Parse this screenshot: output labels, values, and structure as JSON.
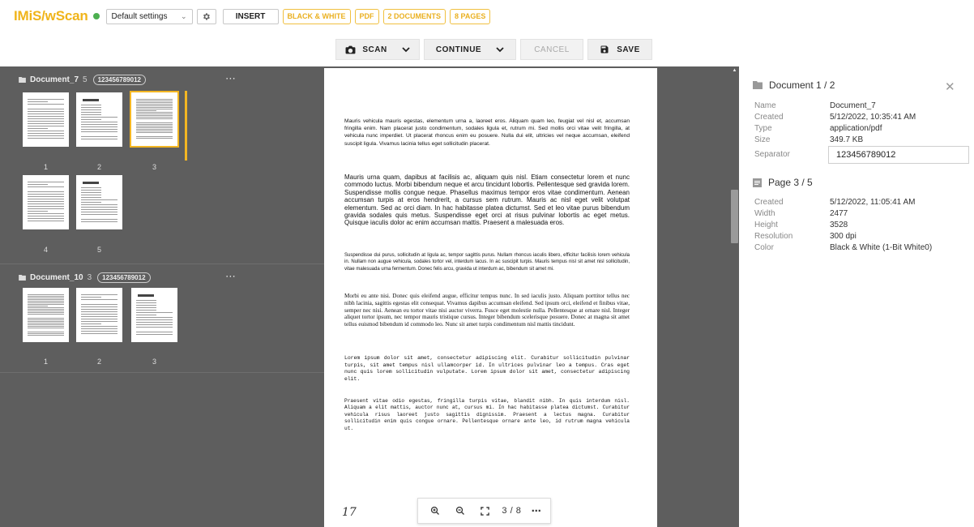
{
  "header": {
    "brand": "IMiS/wScan",
    "settings_value": "Default settings",
    "insert_label": "INSERT",
    "chips": [
      "BLACK & WHITE",
      "PDF",
      "2 DOCUMENTS",
      "8 PAGES"
    ]
  },
  "actions": {
    "scan_label": "SCAN",
    "continue_label": "CONTINUE",
    "cancel_label": "CANCEL",
    "save_label": "SAVE"
  },
  "documents": [
    {
      "name": "Document_7",
      "count": "5",
      "separator": "123456789012",
      "pages": [
        "1",
        "2",
        "3",
        "4",
        "5"
      ],
      "selected_page": "3"
    },
    {
      "name": "Document_10",
      "count": "3",
      "separator": "123456789012",
      "pages": [
        "1",
        "2",
        "3"
      ]
    }
  ],
  "viewer": {
    "paragraphs": [
      "Mauris vehicula mauris egestas, elementum urna a, laoreet eros. Aliquam quam leo, feugiat vel nisl et, accumsan fringilla enim. Nam placerat justo condimentum, sodales ligula et, rutrum mi. Sed mollis orci vitae velit fringilla, at vehicula nunc imperdiet. Ut placerat rhoncus enim eu posuere. Nulla dui elit, ultricies vel neque accumsan, eleifend suscipit ligula. Vivamus lacinia tellus eget sollicitudin placerat.",
      "Mauris urna quam, dapibus at facilisis ac, aliquam quis nisl. Etiam consectetur lorem et nunc commodo luctus. Morbi bibendum neque et arcu tincidunt lobortis. Pellentesque sed gravida lorem. Suspendisse mollis congue neque. Phasellus maximus tempor eros vitae condimentum. Aenean accumsan turpis at eros hendrerit, a cursus sem rutrum. Mauris ac nisl eget velit volutpat elementum. Sed ac orci diam. In hac habitasse platea dictumst. Sed et leo vitae purus bibendum gravida sodales quis metus. Suspendisse eget orci at risus pulvinar lobortis ac eget metus. Quisque iaculis dolor ac enim accumsan mattis. Praesent a malesuada eros.",
      "Suspendisse dui purus, sollicitudin at ligula ac, tempor sagittis purus. Nullam rhoncus iaculis libero, efficitur facilisis lorem vehicula in. Nullam non augue vehicula, sodales tortor vel, interdum lacus. In ac suscipit turpis. Mauris tempus nisl sit amet nisl sollicitudin, vitae malesuada urna fermentum. Donec felis arcu, gravida ut interdum ac, bibendum sit amet mi.",
      "Morbi eu ante nisi. Donec quis eleifend augue, efficitur tempus nunc. In sed iaculis justo. Aliquam porttitor tellus nec nibh lacinia, sagittis egestas elit consequat. Vivamus dapibus accumsan eleifend. Sed ipsum orci, eleifend et finibus vitae, semper nec nisi. Aenean eu tortor vitae nisi auctor viverra. Fusce eget molestie nulla. Pellentesque at ornare nisl. Integer aliquet tortor ipsum, nec tempor mauris tristique cursus. Integer bibendum scelerisque posuere. Donec at magna sit amet tellus euismod bibendum id commodo leo. Nunc sit amet turpis condimentum nisl mattis tincidunt.",
      "Lorem ipsum dolor sit amet, consectetur adipiscing elit. Curabitur sollicitudin pulvinar turpis, sit amet tempus nisl ullamcorper id. In ultrices pulvinar leo a tempus. Cras eget nunc quis lorem sollicitudin vulputate. Lorem ipsum dolor sit amet, consectetur adipiscing elit.",
      "Praesent vitae odio egestas, fringilla turpis vitae, blandit nibh. In quis interdum nisl. Aliquam a elit mattis, auctor nunc at, cursus mi. In hac habitasse platea dictumst. Curabitur vehicula risus laoreet justo sagittis dignissim. Praesent a lectus magna. Curabitur sollicitudin enim quis congue ornare. Pellentesque ornare ante leo, id rutrum magna vehicula ut."
    ],
    "handwriting": "17",
    "page_counter": "3 / 8"
  },
  "info": {
    "doc_title": "Document 1 / 2",
    "doc_fields": [
      {
        "key": "Name",
        "value": "Document_7"
      },
      {
        "key": "Created",
        "value": "5/12/2022, 10:35:41 AM"
      },
      {
        "key": "Type",
        "value": "application/pdf"
      },
      {
        "key": "Size",
        "value": "349.7 KB"
      }
    ],
    "separator_label": "Separator",
    "separator_value": "123456789012",
    "page_title": "Page 3 / 5",
    "page_fields": [
      {
        "key": "Created",
        "value": "5/12/2022, 11:05:41 AM"
      },
      {
        "key": "Width",
        "value": "2477"
      },
      {
        "key": "Height",
        "value": "3528"
      },
      {
        "key": "Resolution",
        "value": "300 dpi"
      },
      {
        "key": "Color",
        "value": "Black & White  (1-Bit White0)"
      }
    ]
  },
  "colors": {
    "accent": "#f0b41a",
    "status": "#4caf50",
    "panel_bg": "#5e5e5e"
  }
}
